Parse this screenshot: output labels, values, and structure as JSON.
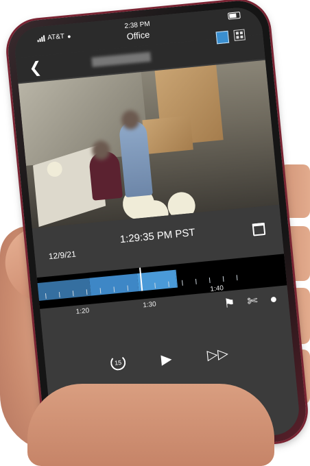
{
  "status_bar": {
    "carrier": "AT&T",
    "time": "2:38 PM",
    "title": "Office"
  },
  "icons": {
    "back": "chevron-left-icon",
    "single_view": "single-view-icon",
    "grid_view": "grid-view-icon",
    "calendar": "calendar-icon",
    "flag": "flag-icon",
    "clip": "scissors-icon",
    "snapshot": "camera-icon",
    "rewind": "rewind-15-icon",
    "play": "play-icon",
    "fast_forward": "fast-forward-icon"
  },
  "playback": {
    "date": "12/9/21",
    "timestamp": "1:29:35 PM PST"
  },
  "timeline": {
    "tick_labels": [
      "1:20",
      "1:30",
      "1:40"
    ],
    "recorded_color": "#3e87c6"
  },
  "controls": {
    "rewind_seconds": "15"
  },
  "colors": {
    "accent": "#3a8fd0",
    "screen_bg": "#3b3b3b",
    "bar_bg": "#2b2b2b"
  }
}
